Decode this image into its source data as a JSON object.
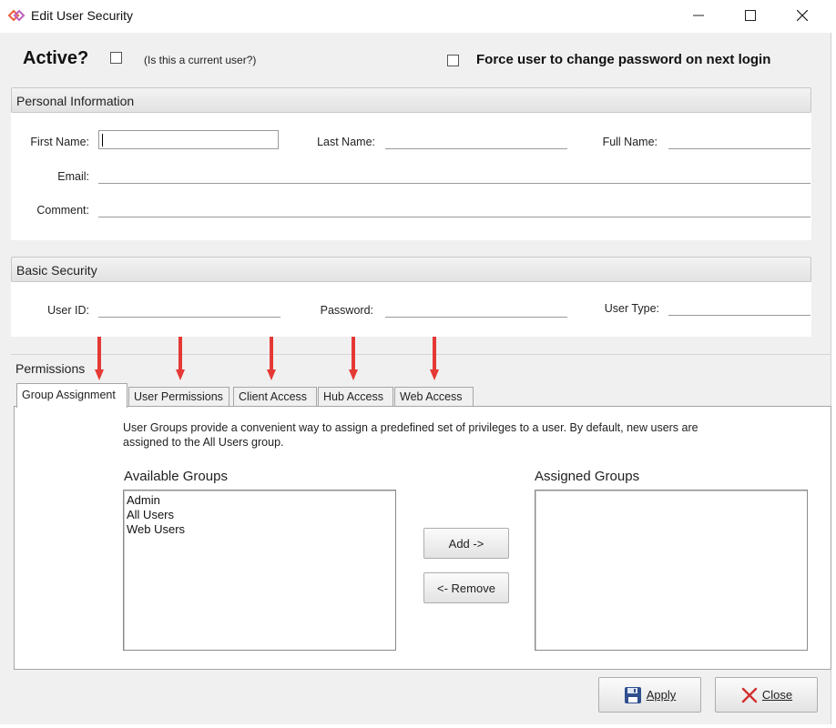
{
  "window": {
    "title": "Edit User Security",
    "minimize_icon": "minimize-icon",
    "maximize_icon": "maximize-icon",
    "close_icon": "close-icon"
  },
  "status": {
    "active_label": "Active?",
    "active_checked": false,
    "current_user_hint": "(Is this a current user?)",
    "force_password_label": "Force user to change password on next login",
    "force_password_checked": false
  },
  "personal_information": {
    "header": "Personal Information",
    "first_name_label": "First Name:",
    "first_name_value": "",
    "last_name_label": "Last Name:",
    "last_name_value": "",
    "full_name_label": "Full Name:",
    "full_name_value": "",
    "email_label": "Email:",
    "email_value": "",
    "comment_label": "Comment:",
    "comment_value": ""
  },
  "basic_security": {
    "header": "Basic Security",
    "user_id_label": "User ID:",
    "user_id_value": "",
    "password_label": "Password:",
    "password_value": "",
    "user_type_label": "User Type:",
    "user_type_value": ""
  },
  "permissions": {
    "header": "Permissions",
    "tabs": [
      {
        "label": "Group Assignment",
        "active": true
      },
      {
        "label": "User Permissions",
        "active": false
      },
      {
        "label": "Client Access",
        "active": false
      },
      {
        "label": "Hub Access",
        "active": false
      },
      {
        "label": "Web Access",
        "active": false
      }
    ],
    "help_text": "User Groups provide a convenient way to assign a predefined set of privileges to a user.  By default, new users are assigned to the All Users group.",
    "available_groups_title": "Available Groups",
    "available_groups": [
      "Admin",
      "All Users",
      "Web Users"
    ],
    "assigned_groups_title": "Assigned Groups",
    "assigned_groups": [],
    "add_button": "Add ->",
    "remove_button": "<- Remove"
  },
  "footer": {
    "apply_button": "Apply",
    "apply_icon": "floppy-disk-icon",
    "close_button": "Close",
    "close_icon": "red-x-icon"
  },
  "colors": {
    "annotation_arrow": "#e53935",
    "dialog_background": "#f0f0f0",
    "close_x": "#d32f2f",
    "save_icon": "#2f4f8f"
  }
}
